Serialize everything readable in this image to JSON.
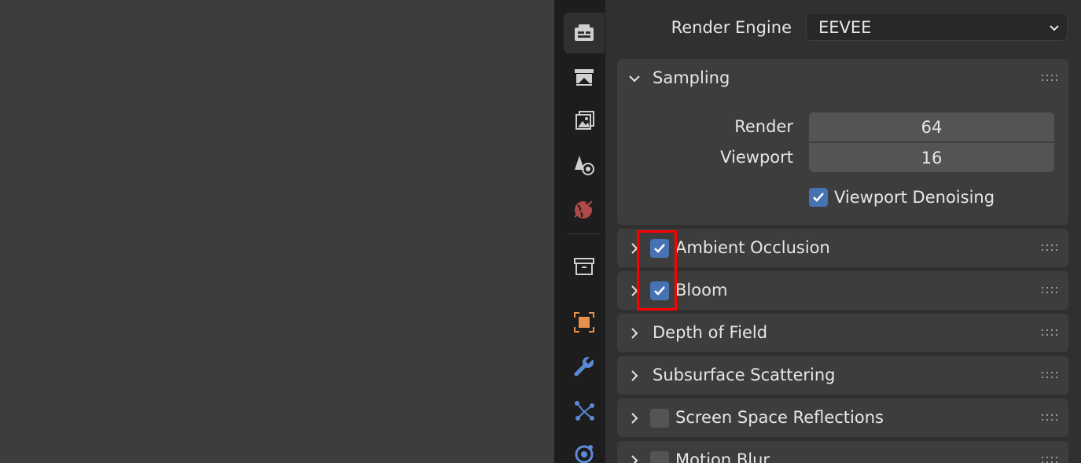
{
  "render_engine": {
    "label": "Render Engine",
    "value": "EEVEE"
  },
  "tabs": [
    {
      "name": "tool-icon",
      "active": true
    },
    {
      "name": "render-icon",
      "active": false
    },
    {
      "name": "output-icon",
      "active": false
    },
    {
      "name": "view-layer-icon",
      "active": false
    },
    {
      "name": "scene-icon",
      "active": false
    },
    {
      "name": "world-icon",
      "active": false
    },
    {
      "name": "collection-icon",
      "active": false
    },
    {
      "name": "object-icon",
      "active": false
    },
    {
      "name": "modifier-icon",
      "active": false
    },
    {
      "name": "particles-icon",
      "active": false
    },
    {
      "name": "physics-icon",
      "active": false
    }
  ],
  "sampling": {
    "title": "Sampling",
    "render_label": "Render",
    "render_value": "64",
    "viewport_label": "Viewport",
    "viewport_value": "16",
    "denoise_label": "Viewport Denoising",
    "denoise_checked": true
  },
  "panels": [
    {
      "title": "Ambient Occlusion",
      "has_checkbox": true,
      "checked": true
    },
    {
      "title": "Bloom",
      "has_checkbox": true,
      "checked": true
    },
    {
      "title": "Depth of Field",
      "has_checkbox": false
    },
    {
      "title": "Subsurface Scattering",
      "has_checkbox": false
    },
    {
      "title": "Screen Space Reflections",
      "has_checkbox": true,
      "checked": false
    },
    {
      "title": "Motion Blur",
      "has_checkbox": true,
      "checked": false
    }
  ],
  "colors": {
    "accent": "#4772b3",
    "highlight": "#ff0000",
    "panel": "#3d3d3d",
    "tab_bar": "#1d1d1d"
  }
}
